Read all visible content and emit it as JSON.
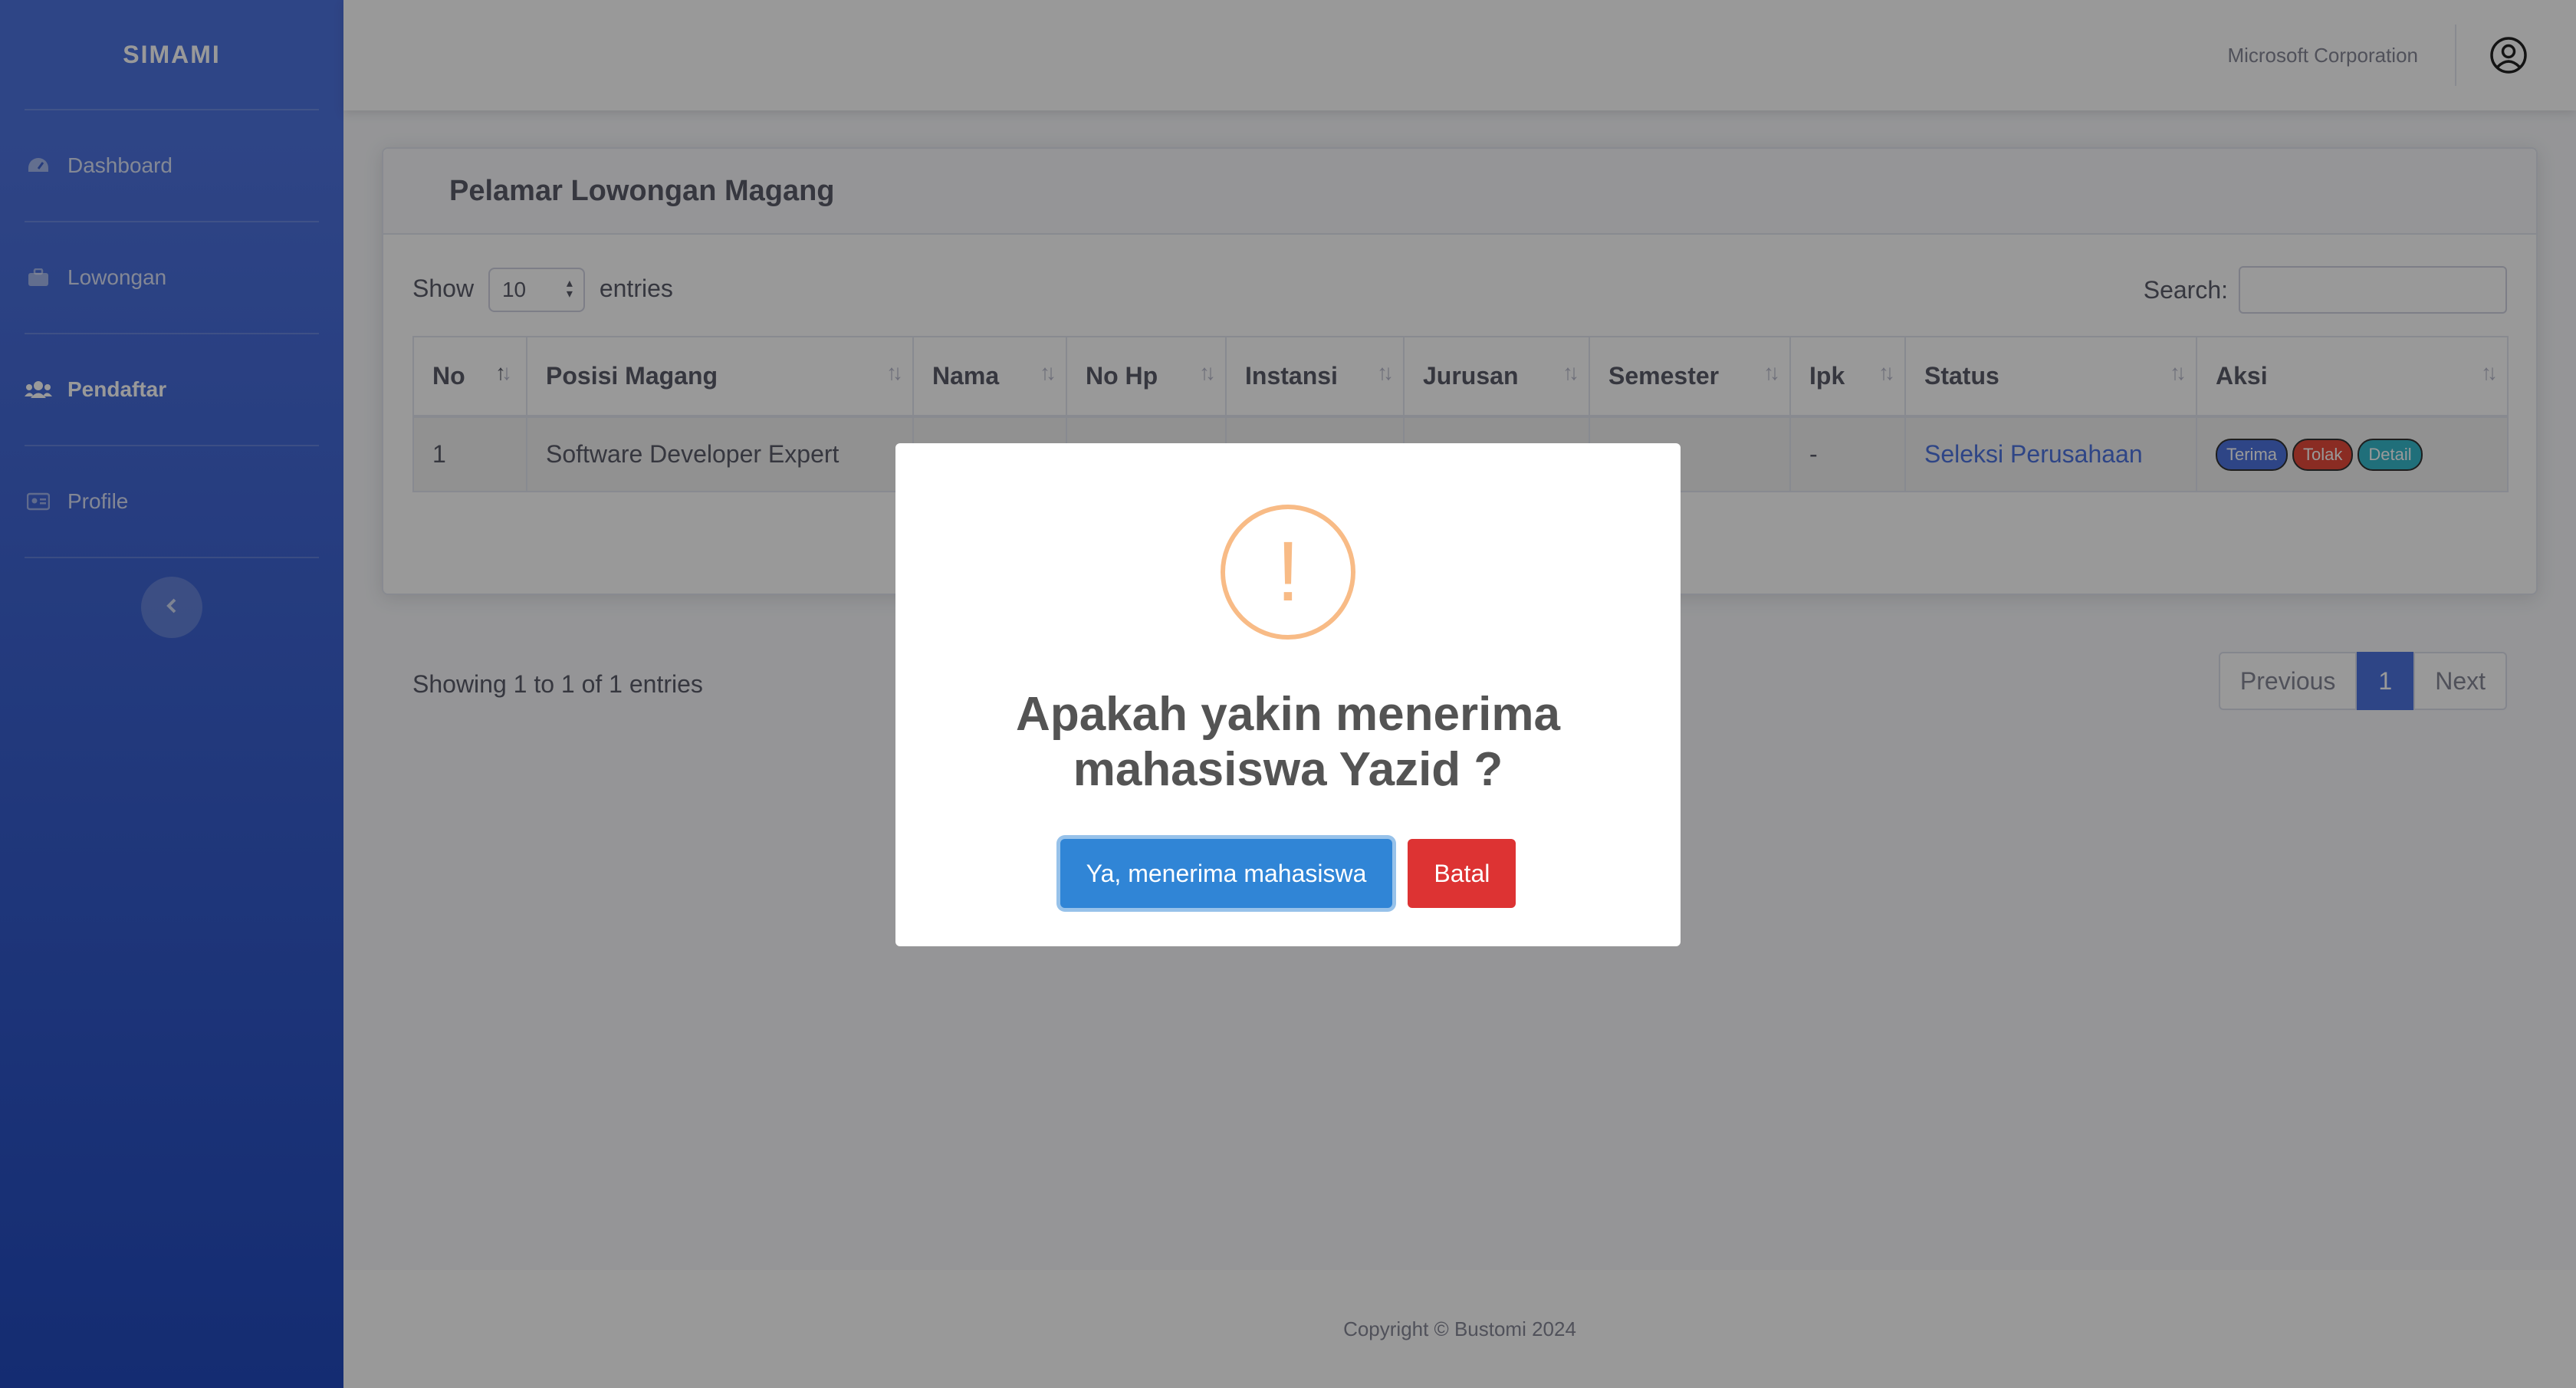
{
  "sidebar": {
    "brand": "SIMAMI",
    "items": [
      {
        "label": "Dashboard",
        "icon": "tachometer-icon",
        "active": false
      },
      {
        "label": "Lowongan",
        "icon": "briefcase-icon",
        "active": false
      },
      {
        "label": "Pendaftar",
        "icon": "users-icon",
        "active": true
      },
      {
        "label": "Profile",
        "icon": "id-card-icon",
        "active": false
      }
    ],
    "toggle_icon": "chevron-left-icon"
  },
  "topbar": {
    "company": "Microsoft Corporation",
    "user_icon": "user-circle-icon"
  },
  "card": {
    "title": "Pelamar Lowongan Magang",
    "show_label": "Show",
    "show_value": "10",
    "entries_label": "entries",
    "search_label": "Search:",
    "search_value": ""
  },
  "table": {
    "headers": [
      "No",
      "Posisi Magang",
      "Nama",
      "No Hp",
      "Instansi",
      "Jurusan",
      "Semester",
      "Ipk",
      "Status",
      "Aksi"
    ],
    "rows": [
      {
        "no": "1",
        "posisi": "Software Developer Expert",
        "nama": "",
        "nohp": "",
        "instansi": "",
        "jurusan": "",
        "semester": "",
        "ipk": "-",
        "status": "Seleksi Perusahaan",
        "actions": [
          "Terima",
          "Tolak",
          "Detail"
        ]
      }
    ],
    "info": "Showing 1 to 1 of 1 entries",
    "pagination": {
      "previous": "Previous",
      "current": "1",
      "next": "Next"
    }
  },
  "footer": {
    "text": "Copyright © Bustomi 2024"
  },
  "modal": {
    "icon": "exclamation-icon",
    "title": "Apakah yakin menerima mahasiswa Yazid ?",
    "confirm_label": "Ya, menerima mahasiswa",
    "cancel_label": "Batal"
  },
  "colors": {
    "sidebar_start": "#4e73df",
    "sidebar_end": "#224abe",
    "primary": "#4e73df",
    "danger": "#e74a3b",
    "info": "#36b9cc",
    "warning_icon": "#f8bb86",
    "confirm": "#3085d6",
    "cancel": "#dd3333"
  }
}
